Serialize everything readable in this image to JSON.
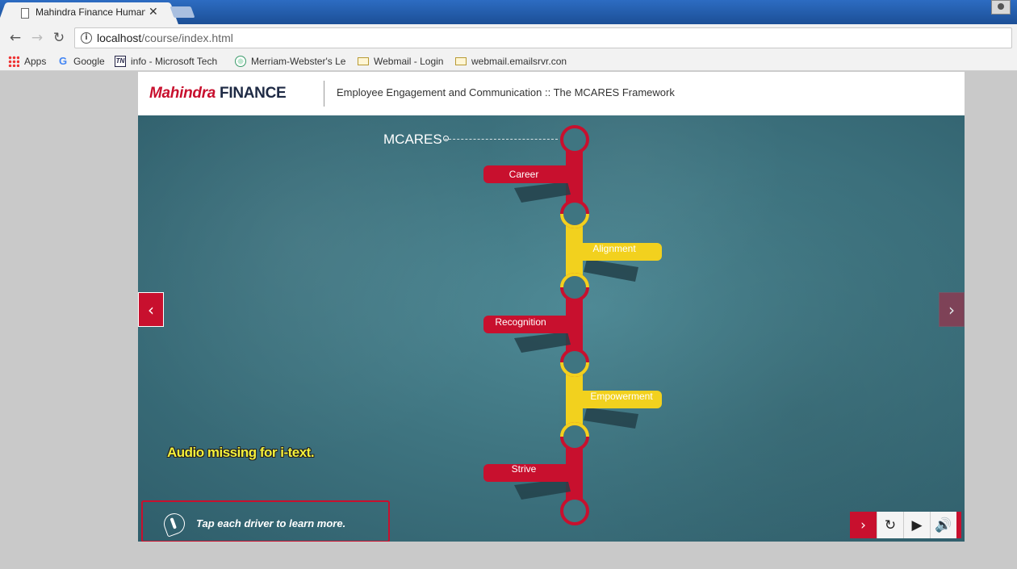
{
  "browser": {
    "tab_title": "Mahindra Finance Human",
    "tab_close": "✕",
    "url_host": "localhost",
    "url_path": "/course/index.html",
    "bookmarks": [
      {
        "label": "Apps",
        "icon": "apps-icon"
      },
      {
        "label": "Google",
        "icon": "google-icon"
      },
      {
        "label": "info - Microsoft Tech",
        "icon": "technet-icon"
      },
      {
        "label": "Merriam-Webster's Le",
        "icon": "globe-icon"
      },
      {
        "label": "Webmail - Login",
        "icon": "mail-icon"
      },
      {
        "label": "webmail.emailsrvr.con",
        "icon": "mail-icon"
      }
    ]
  },
  "header": {
    "logo_brand": "Mahindra",
    "logo_suffix": "FINANCE",
    "course_title": "Employee Engagement and Communication :: The MCARES Framework"
  },
  "stage": {
    "mcares_label": "MCARES",
    "drivers": [
      {
        "label": "Career",
        "color": "red",
        "side": "left"
      },
      {
        "label": "Alignment",
        "color": "yellow",
        "side": "right"
      },
      {
        "label": "Recognition",
        "color": "red",
        "side": "left"
      },
      {
        "label": "Empowerment",
        "color": "yellow",
        "side": "right"
      },
      {
        "label": "Strive",
        "color": "red",
        "side": "left"
      }
    ],
    "audio_warning": "Audio missing for i-text.",
    "instruction": "Tap each driver to learn more.",
    "prev_icon": "‹",
    "next_icon": "›"
  },
  "controls": [
    {
      "name": "next-control",
      "icon": "›"
    },
    {
      "name": "replay-control",
      "icon": "↻"
    },
    {
      "name": "play-control",
      "icon": "▶"
    },
    {
      "name": "volume-control",
      "icon": "🔊"
    }
  ],
  "colors": {
    "brand_red": "#c8102e",
    "driver_yellow": "#f2d11e",
    "stage_teal": "#3f7581"
  }
}
